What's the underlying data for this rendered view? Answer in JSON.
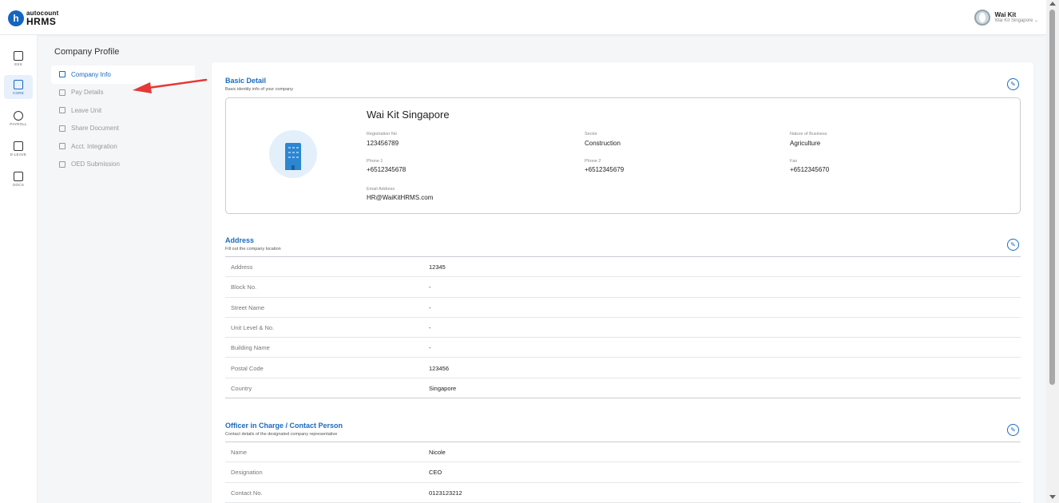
{
  "header": {
    "logo_mark": "h",
    "logo_top": "autocount",
    "logo_bottom": "HRMS",
    "user_name": "Wai Kit",
    "user_company": "Wai Kit Singapore ⌄"
  },
  "rail": [
    {
      "label": "ESS",
      "icon": "calculator-icon"
    },
    {
      "label": "CORE",
      "icon": "cube-icon"
    },
    {
      "label": "PAYROLL",
      "icon": "dollar-coin-icon"
    },
    {
      "label": "E-LEAVE",
      "icon": "calendar-icon"
    },
    {
      "label": "DOCS",
      "icon": "document-icon"
    }
  ],
  "subnav": {
    "title": "Company Profile",
    "items": [
      "Company Info",
      "Pay Details",
      "Leave Unit",
      "Share Document",
      "Acct. Integration",
      "OED Submission"
    ]
  },
  "basic": {
    "title": "Basic Detail",
    "subtitle": "Basic identity info of your company",
    "company_name": "Wai Kit Singapore",
    "fields": {
      "reg_label": "Registration No",
      "reg_value": "123456789",
      "sector_label": "Sector",
      "sector_value": "Construction",
      "nature_label": "Nature of Business",
      "nature_value": "Agriculture",
      "phone1_label": "Phone 1",
      "phone1_value": "+6512345678",
      "phone2_label": "Phone 2",
      "phone2_value": "+6512345679",
      "fax_label": "Fax",
      "fax_value": "+6512345670",
      "email_label": "Email Address",
      "email_value": "HR@WaiKitHRMS.com"
    }
  },
  "address": {
    "title": "Address",
    "subtitle": "Fill out the company location",
    "rows": [
      {
        "label": "Address",
        "value": "12345"
      },
      {
        "label": "Block No.",
        "value": "-"
      },
      {
        "label": "Street Name",
        "value": "-"
      },
      {
        "label": "Unit Level & No.",
        "value": "-"
      },
      {
        "label": "Building Name",
        "value": "-"
      },
      {
        "label": "Postal Code",
        "value": "123456"
      },
      {
        "label": "Country",
        "value": "Singapore"
      }
    ]
  },
  "officer": {
    "title": "Officer in Charge / Contact Person",
    "subtitle": "Contact details of the designated company representative",
    "rows": [
      {
        "label": "Name",
        "value": "Nicole"
      },
      {
        "label": "Designation",
        "value": "CEO"
      },
      {
        "label": "Contact No.",
        "value": "0123123212"
      }
    ]
  },
  "colors": {
    "accent": "#1a6bbf",
    "arrow": "#e53935",
    "building": "#2e86d1"
  }
}
